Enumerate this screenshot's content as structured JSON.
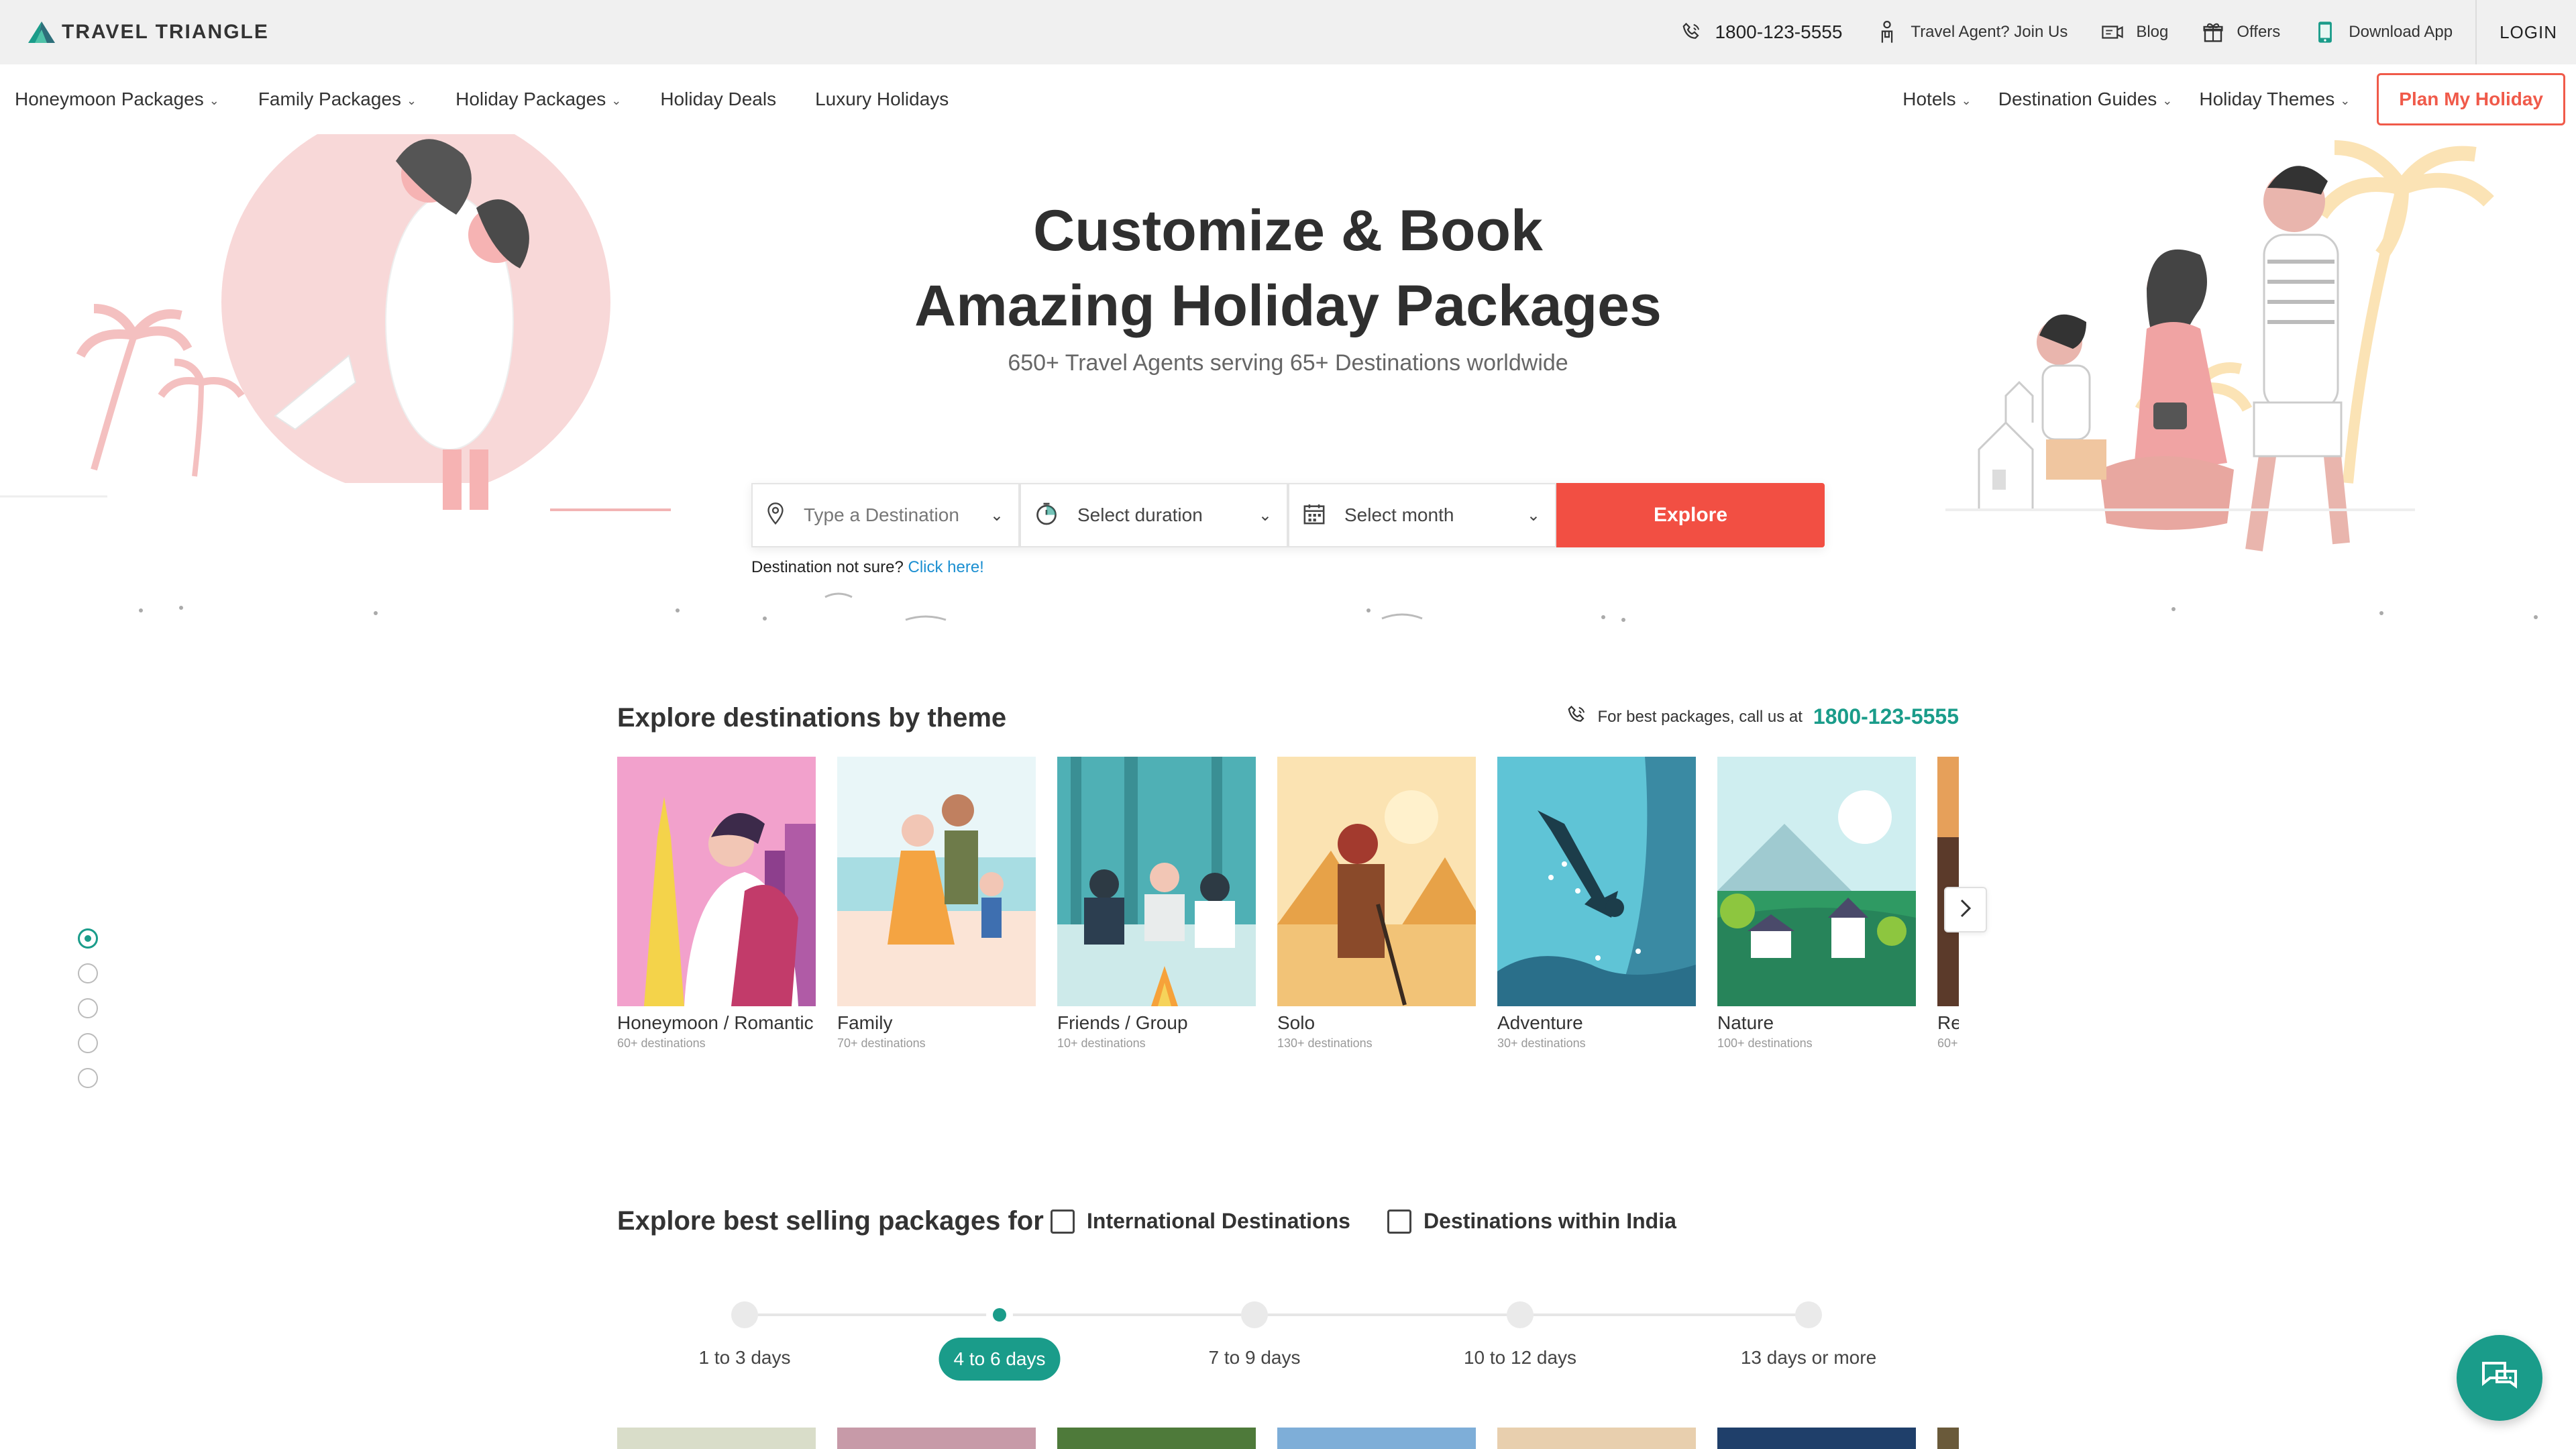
{
  "colors": {
    "accent_teal": "#1a9c8a",
    "cta_red": "#f24f43",
    "plan_border": "#f05a4a",
    "link_blue": "#1b8fd1"
  },
  "topbar": {
    "logo_text": "TRAVEL TRIANGLE",
    "logo_icon": "triangle-logo-icon",
    "phone": "1800-123-5555",
    "agent_label": "Travel Agent? Join Us",
    "blog_label": "Blog",
    "offers_label": "Offers",
    "download_label": "Download App",
    "login_label": "LOGIN"
  },
  "nav": {
    "left": [
      {
        "label": "Honeymoon Packages",
        "has_dropdown": true
      },
      {
        "label": "Family Packages",
        "has_dropdown": true
      },
      {
        "label": "Holiday Packages",
        "has_dropdown": true
      },
      {
        "label": "Holiday Deals",
        "has_dropdown": false
      },
      {
        "label": "Luxury Holidays",
        "has_dropdown": false
      }
    ],
    "right": [
      {
        "label": "Hotels",
        "has_dropdown": true
      },
      {
        "label": "Destination Guides",
        "has_dropdown": true
      },
      {
        "label": "Holiday Themes",
        "has_dropdown": true
      }
    ],
    "plan_button": "Plan My Holiday"
  },
  "hero": {
    "title_line1": "Customize & Book",
    "title_line2": "Amazing Holiday Packages",
    "subtitle": "650+ Travel Agents serving 65+ Destinations worldwide",
    "search": {
      "destination_placeholder": "Type a Destination",
      "duration_value": "Select duration",
      "month_value": "Select month",
      "explore_label": "Explore"
    },
    "not_sure_text": "Destination not sure?",
    "not_sure_link": "Click here!"
  },
  "themes": {
    "title": "Explore destinations by theme",
    "call_label": "For best packages, call us at",
    "call_number": "1800-123-5555",
    "cards": [
      {
        "name": "Honeymoon / Romantic",
        "count": "60+ destinations"
      },
      {
        "name": "Family",
        "count": "70+ destinations"
      },
      {
        "name": "Friends / Group",
        "count": "10+ destinations"
      },
      {
        "name": "Solo",
        "count": "130+ destinations"
      },
      {
        "name": "Adventure",
        "count": "30+ destinations"
      },
      {
        "name": "Nature",
        "count": "100+ destinations"
      },
      {
        "name": "Re",
        "count": "60+"
      }
    ]
  },
  "side_nav": {
    "active_index": 0,
    "count": 5
  },
  "best_selling": {
    "title": "Explore best selling packages for",
    "options": [
      {
        "label": "International Destinations",
        "checked": false
      },
      {
        "label": "Destinations within India",
        "checked": false
      }
    ],
    "durations": [
      {
        "label": "1 to 3 days",
        "active": false
      },
      {
        "label": "4 to 6 days",
        "active": true
      },
      {
        "label": "7 to 9 days",
        "active": false
      },
      {
        "label": "10 to 12 days",
        "active": false
      },
      {
        "label": "13 days or more",
        "active": false
      }
    ]
  }
}
